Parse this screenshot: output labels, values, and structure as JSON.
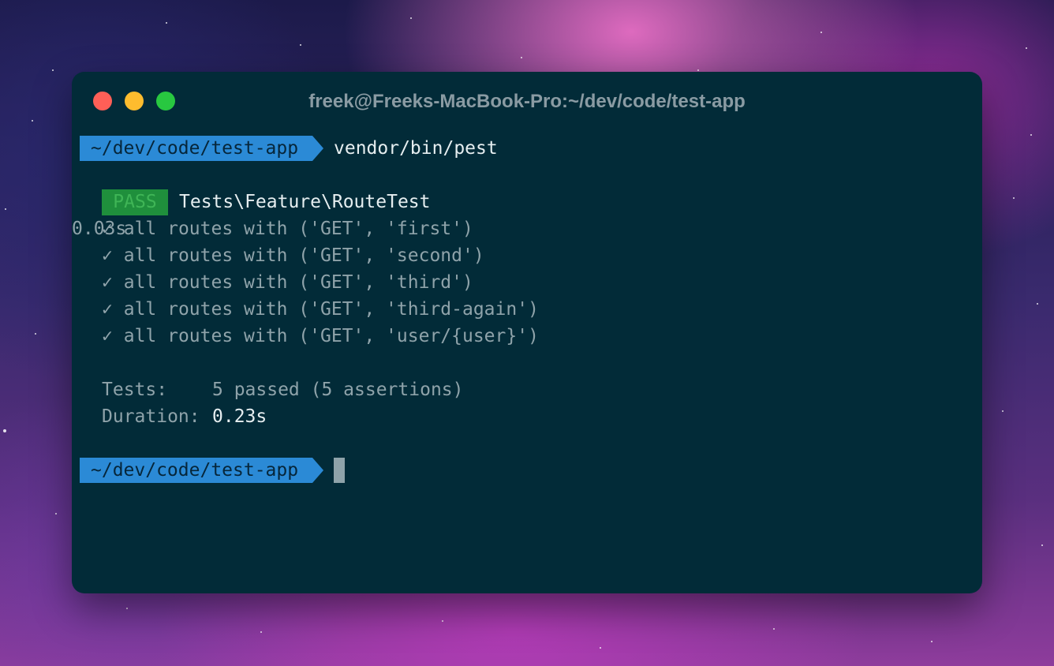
{
  "window": {
    "title": "freek@Freeks-MacBook-Pro:~/dev/code/test-app"
  },
  "terminal": {
    "prompt_path": "~/dev/code/test-app",
    "command": "vendor/bin/pest",
    "status_badge": "PASS",
    "suite_name": "Tests\\Feature\\RouteTest",
    "tests": [
      {
        "mark": "✓",
        "text": "all routes with ('GET', 'first')",
        "duration": "0.03s"
      },
      {
        "mark": "✓",
        "text": "all routes with ('GET', 'second')"
      },
      {
        "mark": "✓",
        "text": "all routes with ('GET', 'third')"
      },
      {
        "mark": "✓",
        "text": "all routes with ('GET', 'third-again')"
      },
      {
        "mark": "✓",
        "text": "all routes with ('GET', 'user/{user}')"
      }
    ],
    "summary": {
      "tests_label": "Tests:",
      "tests_value": "5 passed (5 assertions)",
      "duration_label": "Duration:",
      "duration_value": "0.23s"
    },
    "second_prompt_path": "~/dev/code/test-app"
  },
  "colors": {
    "terminal_bg": "#022b38",
    "prompt_bg": "#2b8ad6",
    "pass_bg": "#1f8f3c",
    "light_red": "#ff5f57",
    "light_yellow": "#febc2e",
    "light_green": "#28c840"
  }
}
